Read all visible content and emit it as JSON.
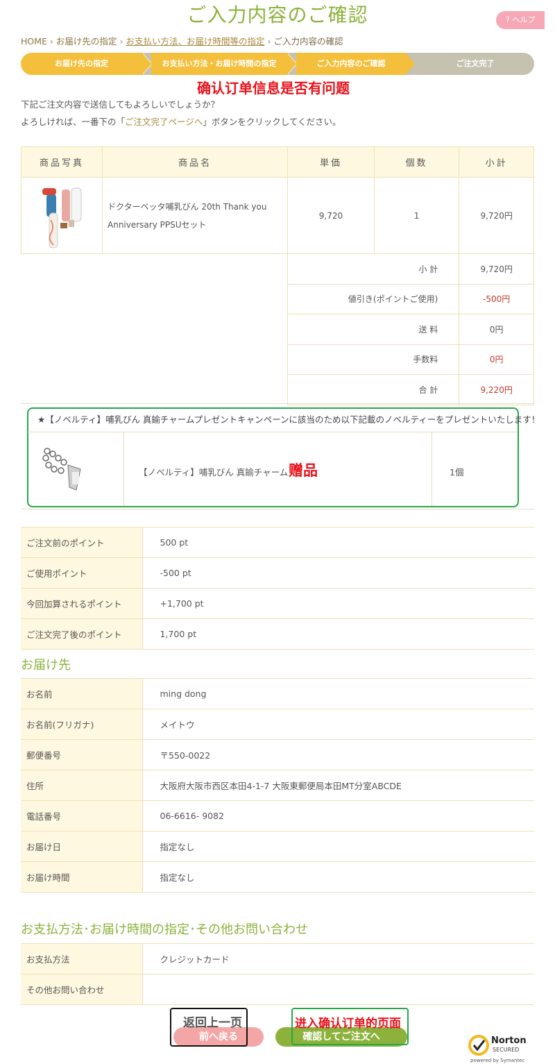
{
  "header": {
    "title": "ご入力内容のご確認",
    "help": "? ヘルプ"
  },
  "breadcrumb": {
    "home": "HOME",
    "step1": "お届け先の指定",
    "step2": "お支払い方法、お届け時間等の指定",
    "current": "ご入力内容の確認"
  },
  "steps": [
    {
      "label": "お届け先の指定"
    },
    {
      "label": "お支払い方法・お届け時間の指定"
    },
    {
      "label": "ご入力内容のご確認"
    },
    {
      "label": "ご注文完了"
    }
  ],
  "annotations": {
    "confirm": "确认订单信息是否有问题",
    "gift": "赠品",
    "back": "返回上一页",
    "next": "进入确认订单的页面"
  },
  "intro": {
    "line1": "下記ご注文内容で送信してもよろしいでしょうか？",
    "line2_pre": "よろしければ、一番下の「",
    "line2_link": "ご注文完了ページへ",
    "line2_post": "」ボタンをクリックしてください。"
  },
  "order": {
    "headers": [
      "商品写真",
      "商品名",
      "単価",
      "個数",
      "小計"
    ],
    "item": {
      "name_line1": "ドクターベッタ哺乳びん 20th Thank you",
      "name_line2": "Anniversary PPSUセット",
      "unit_price": "9,720",
      "qty": "1",
      "subtotal": "9,720円"
    },
    "summary": [
      {
        "label": "小 計",
        "value": "9,720円"
      },
      {
        "label": "値引き(ポイントご使用)",
        "value": "-500円"
      },
      {
        "label": "送 料",
        "value": "0円"
      },
      {
        "label": "手数料",
        "value": "0円"
      },
      {
        "label": "合 計",
        "value": "9,220円"
      }
    ]
  },
  "novelty": {
    "title": "★【ノベルティ】哺乳びん 真鍮チャームプレゼントキャンペーンに該当のため以下記載のノベルティーをプレゼントいたします！",
    "name": "【ノベルティ】哺乳びん 真鍮チャーム",
    "qty": "1個"
  },
  "points": [
    {
      "label": "ご注文前のポイント",
      "value": "500 pt"
    },
    {
      "label": "ご使用ポイント",
      "value": "-500 pt"
    },
    {
      "label": "今回加算されるポイント",
      "value": "+1,700 pt"
    },
    {
      "label": "ご注文完了後のポイント",
      "value": "1,700 pt"
    }
  ],
  "delivery": {
    "heading": "お届け先",
    "rows": [
      {
        "label": "お名前",
        "value": "ming dong"
      },
      {
        "label": "お名前(フリガナ)",
        "value": "メイトウ"
      },
      {
        "label": "郵便番号",
        "value": "〒550-0022"
      },
      {
        "label": "住所",
        "value": "大阪府大阪市西区本田4-1-7 大阪東郵便局本田MT分室ABCDE"
      },
      {
        "label": "電話番号",
        "value": "06-6616- 9082"
      },
      {
        "label": "お届け日",
        "value": "指定なし"
      },
      {
        "label": "お届け時間",
        "value": "指定なし"
      }
    ]
  },
  "payment": {
    "heading": "お支払方法･お届け時間の指定･その他お問い合わせ",
    "rows": [
      {
        "label": "お支払方法",
        "value": "クレジットカード"
      },
      {
        "label": "その他お問い合わせ",
        "value": ""
      }
    ]
  },
  "buttons": {
    "back": "前へ戻る",
    "next": "確認してご注文へ"
  },
  "norton": {
    "brand": "Norton",
    "secured": "SECURED",
    "powered": "powered by Symantec"
  },
  "colors": {
    "accent_green": "#8cb23c",
    "step_yellow": "#f4c03c",
    "annotation_red": "#e8101a",
    "box_green": "#25a84a"
  }
}
